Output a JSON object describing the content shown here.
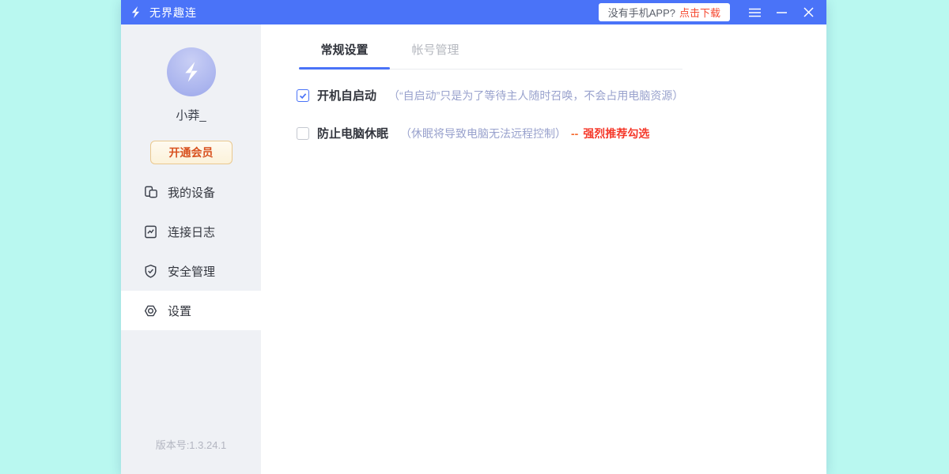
{
  "titlebar": {
    "app_name": "无界趣连",
    "download_prompt": "没有手机APP?",
    "download_action": "点击下载"
  },
  "sidebar": {
    "username": "小莽_",
    "vip_button_label": "开通会员",
    "items": [
      {
        "label": "我的设备",
        "icon": "devices-icon",
        "active": false
      },
      {
        "label": "连接日志",
        "icon": "connection-log-icon",
        "active": false
      },
      {
        "label": "安全管理",
        "icon": "security-shield-icon",
        "active": false
      },
      {
        "label": "设置",
        "icon": "settings-icon",
        "active": true
      }
    ],
    "version_label": "版本号:1.3.24.1"
  },
  "content": {
    "tabs": [
      {
        "label": "常规设置",
        "active": true
      },
      {
        "label": "帐号管理",
        "active": false
      }
    ],
    "settings": [
      {
        "label": "开机自启动",
        "checked": true,
        "note": "（“自启动”只是为了等待主人随时召唤，不会占用电脑资源）"
      },
      {
        "label": "防止电脑休眠",
        "checked": false,
        "note": "（休眠将导致电脑无法远程控制）",
        "dash": "--",
        "highlight": "强烈推荐勾选"
      }
    ]
  },
  "colors": {
    "titlebar_blue": "#4a73f8",
    "desktop_cyan": "#b9f8f0",
    "sidebar_gray": "#eff1f5",
    "note_periwinkle": "#99a2cd",
    "alert_red": "#f5392b",
    "vip_text_orange": "#d8511f",
    "vip_border_gold": "#e9c88f",
    "avatar_lavender": "#aab4ee"
  }
}
